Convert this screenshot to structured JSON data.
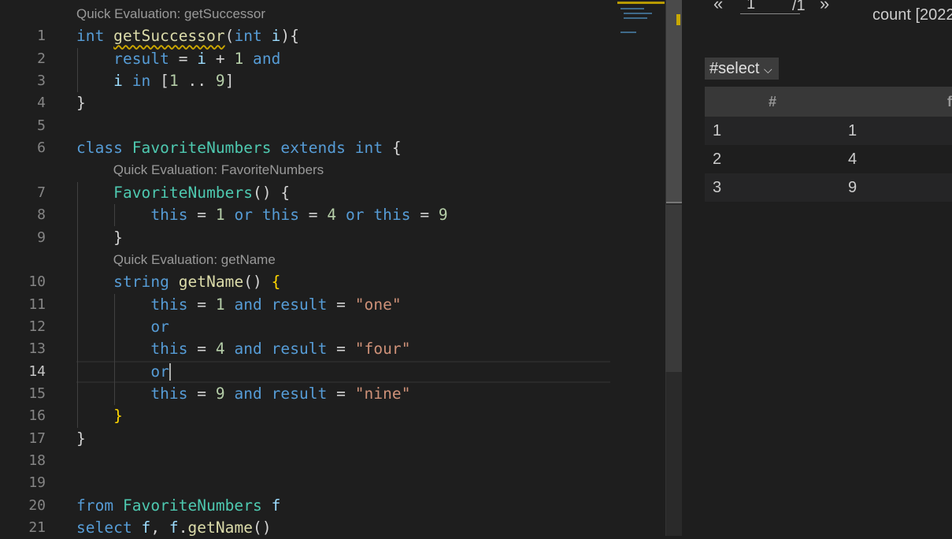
{
  "editor": {
    "lenses": [
      {
        "before": 1,
        "text": "Quick Evaluation: getSuccessor",
        "indent": 0
      },
      {
        "before": 7,
        "text": "Quick Evaluation: FavoriteNumbers",
        "indent": 4
      },
      {
        "before": 10,
        "text": "Quick Evaluation: getName",
        "indent": 4
      }
    ],
    "current_line": 14,
    "lines": [
      [
        [
          "int",
          "kw"
        ],
        [
          " ",
          "pu"
        ],
        [
          "getSuccessor",
          "fn squig"
        ],
        [
          "(",
          "pu"
        ],
        [
          "int",
          "kw"
        ],
        [
          " ",
          "pu"
        ],
        [
          "i",
          "va"
        ],
        [
          "){",
          "pu"
        ]
      ],
      [
        [
          "    ",
          "pu"
        ],
        [
          "result",
          "kw"
        ],
        [
          " = ",
          "pu"
        ],
        [
          "i",
          "va"
        ],
        [
          " + ",
          "pu"
        ],
        [
          "1",
          "nu"
        ],
        [
          " and",
          "kw"
        ]
      ],
      [
        [
          "    ",
          "pu"
        ],
        [
          "i",
          "va"
        ],
        [
          " in ",
          "kw"
        ],
        [
          "[",
          "pu"
        ],
        [
          "1",
          "nu"
        ],
        [
          " .. ",
          "pu"
        ],
        [
          "9",
          "nu"
        ],
        [
          "]",
          "pu"
        ]
      ],
      [
        [
          "}",
          "pu"
        ]
      ],
      [],
      [
        [
          "class ",
          "kw"
        ],
        [
          "FavoriteNumbers",
          "ty"
        ],
        [
          " extends ",
          "kw"
        ],
        [
          "int",
          "kw"
        ],
        [
          " {",
          "pu"
        ]
      ],
      [
        [
          "    ",
          "pu"
        ],
        [
          "FavoriteNumbers",
          "ty"
        ],
        [
          "() {",
          "pu"
        ]
      ],
      [
        [
          "        ",
          "pu"
        ],
        [
          "this",
          "kw"
        ],
        [
          " = ",
          "pu"
        ],
        [
          "1",
          "nu"
        ],
        [
          " or ",
          "kw"
        ],
        [
          "this",
          "kw"
        ],
        [
          " = ",
          "pu"
        ],
        [
          "4",
          "nu"
        ],
        [
          " or ",
          "kw"
        ],
        [
          "this",
          "kw"
        ],
        [
          " = ",
          "pu"
        ],
        [
          "9",
          "nu"
        ]
      ],
      [
        [
          "    }",
          "pu"
        ]
      ],
      [
        [
          "    ",
          "pu"
        ],
        [
          "string",
          "kw"
        ],
        [
          " ",
          "pu"
        ],
        [
          "getName",
          "fn"
        ],
        [
          "() ",
          "pu"
        ],
        [
          "{",
          "br"
        ]
      ],
      [
        [
          "        ",
          "pu"
        ],
        [
          "this",
          "kw"
        ],
        [
          " = ",
          "pu"
        ],
        [
          "1",
          "nu"
        ],
        [
          " and ",
          "kw"
        ],
        [
          "result",
          "kw"
        ],
        [
          " = ",
          "pu"
        ],
        [
          "\"one\"",
          "st"
        ]
      ],
      [
        [
          "        ",
          "pu"
        ],
        [
          "or",
          "kw"
        ]
      ],
      [
        [
          "        ",
          "pu"
        ],
        [
          "this",
          "kw"
        ],
        [
          " = ",
          "pu"
        ],
        [
          "4",
          "nu"
        ],
        [
          " and ",
          "kw"
        ],
        [
          "result",
          "kw"
        ],
        [
          " = ",
          "pu"
        ],
        [
          "\"four\"",
          "st"
        ]
      ],
      [
        [
          "        ",
          "pu"
        ],
        [
          "or",
          "kw"
        ]
      ],
      [
        [
          "        ",
          "pu"
        ],
        [
          "this",
          "kw"
        ],
        [
          " = ",
          "pu"
        ],
        [
          "9",
          "nu"
        ],
        [
          " and ",
          "kw"
        ],
        [
          "result",
          "kw"
        ],
        [
          " = ",
          "pu"
        ],
        [
          "\"nine\"",
          "st"
        ]
      ],
      [
        [
          "    ",
          "pu"
        ],
        [
          "}",
          "br"
        ]
      ],
      [
        [
          "}",
          "pu"
        ]
      ],
      [],
      [],
      [
        [
          "from ",
          "kw"
        ],
        [
          "FavoriteNumbers",
          "ty"
        ],
        [
          " f",
          "va"
        ]
      ],
      [
        [
          "select ",
          "kw"
        ],
        [
          "f",
          "va"
        ],
        [
          ", ",
          "pu"
        ],
        [
          "f",
          "va"
        ],
        [
          ".",
          "pu"
        ],
        [
          "getName",
          "fn"
        ],
        [
          "()",
          "pu"
        ]
      ]
    ]
  },
  "results": {
    "prev": "«",
    "page": "1",
    "total": "/1",
    "next": "»",
    "count": "count [2022",
    "result_set": "#select",
    "columns": [
      "#",
      "f"
    ],
    "rows": [
      [
        "1",
        "1"
      ],
      [
        "2",
        "4"
      ],
      [
        "3",
        "9"
      ]
    ]
  },
  "colors": {
    "keyword": "#569cd6",
    "type": "#4ec9b0",
    "function": "#dcdcaa",
    "number": "#b5cea8",
    "string": "#ce9178",
    "warning": "#cca700"
  }
}
